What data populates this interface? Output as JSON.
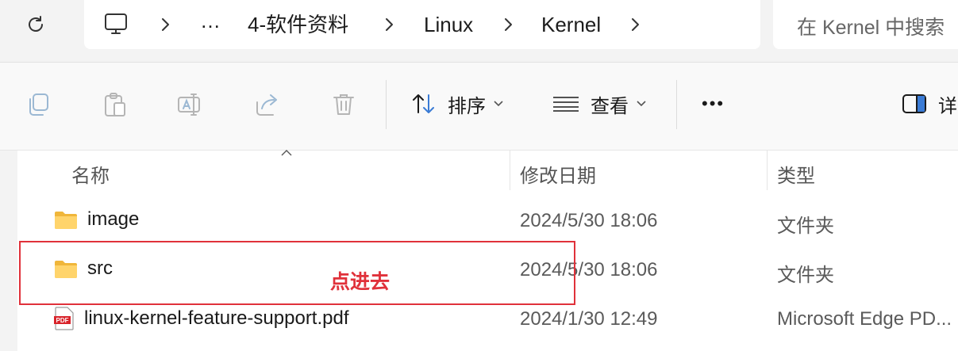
{
  "addressbar": {
    "breadcrumbs": [
      "…",
      "4-软件资料",
      "Linux",
      "Kernel"
    ],
    "search_placeholder": "在 Kernel 中搜索"
  },
  "toolbar": {
    "sort_label": "排序",
    "view_label": "查看",
    "more_label": "•••",
    "details_label": "详"
  },
  "columns": {
    "name": "名称",
    "date": "修改日期",
    "type": "类型"
  },
  "files": [
    {
      "name": "image",
      "date": "2024/5/30 18:06",
      "type": "文件夹",
      "icon": "folder-icon"
    },
    {
      "name": "src",
      "date": "2024/5/30 18:06",
      "type": "文件夹",
      "icon": "folder-icon"
    },
    {
      "name": "linux-kernel-feature-support.pdf",
      "date": "2024/1/30 12:49",
      "type": "Microsoft Edge PD...",
      "icon": "pdf-icon"
    }
  ],
  "annotation": {
    "text": "点进去",
    "color": "#e0313a"
  }
}
